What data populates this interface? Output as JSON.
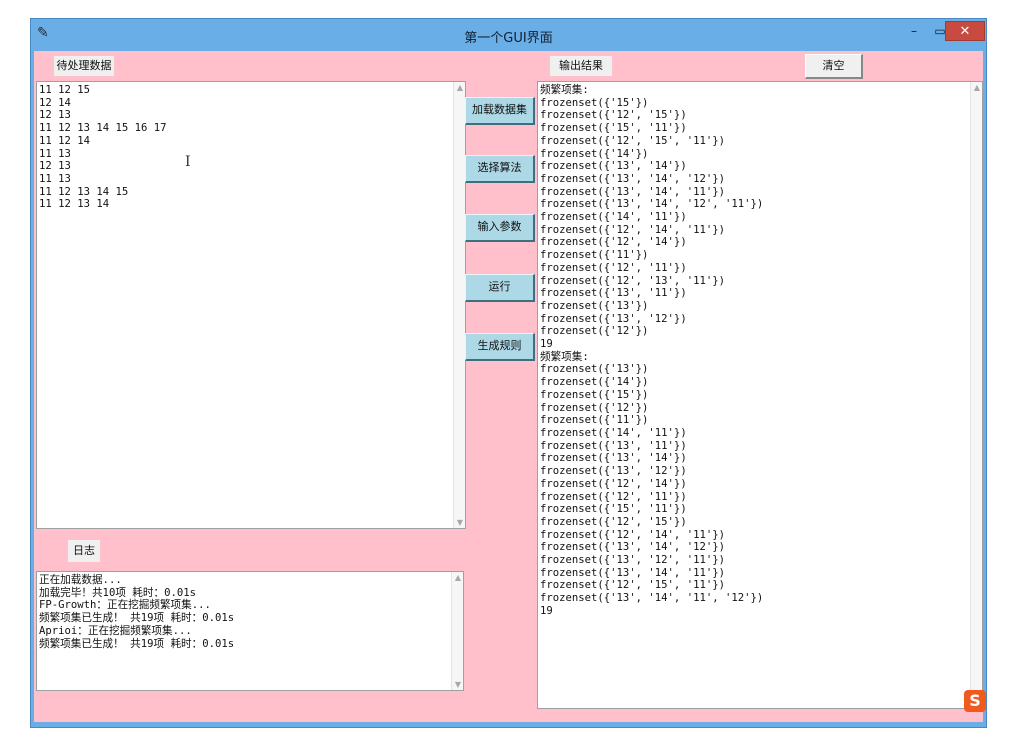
{
  "window": {
    "title": "第一个GUI界面",
    "app_icon": "feather-icon",
    "controls": {
      "minimize": "–",
      "maximize": "▭",
      "close": "✕"
    }
  },
  "input_panel": {
    "label": "待处理数据",
    "lines": [
      "11 12 15",
      "12 14",
      "12 13",
      "11 12 13 14 15 16 17",
      "11 12 14",
      "11 13",
      "12 13",
      "11 13",
      "11 12 13 14 15",
      "11 12 13 14"
    ]
  },
  "log_panel": {
    "label": "日志",
    "lines": [
      "正在加载数据...",
      "加载完毕！共10项 耗时：0.01s",
      "FP-Growth：正在挖掘频繁项集...",
      "频繁项集已生成！ 共19项 耗时：0.01s",
      "Aprioi：正在挖掘频繁项集...",
      "频繁项集已生成！ 共19项 耗时：0.01s"
    ]
  },
  "actions": [
    {
      "name": "load-data-button",
      "label": "加载数据集"
    },
    {
      "name": "select-algorithm-button",
      "label": "选择算法"
    },
    {
      "name": "input-params-button",
      "label": "输入参数"
    },
    {
      "name": "run-button",
      "label": "运行"
    },
    {
      "name": "generate-rules-button",
      "label": "生成规则"
    }
  ],
  "output_panel": {
    "label": "输出结果",
    "clear_label": "清空",
    "lines": [
      "频繁项集:",
      "frozenset({'15'})",
      "frozenset({'12', '15'})",
      "frozenset({'15', '11'})",
      "frozenset({'12', '15', '11'})",
      "frozenset({'14'})",
      "frozenset({'13', '14'})",
      "frozenset({'13', '14', '12'})",
      "frozenset({'13', '14', '11'})",
      "frozenset({'13', '14', '12', '11'})",
      "frozenset({'14', '11'})",
      "frozenset({'12', '14', '11'})",
      "frozenset({'12', '14'})",
      "frozenset({'11'})",
      "frozenset({'12', '11'})",
      "frozenset({'12', '13', '11'})",
      "frozenset({'13', '11'})",
      "frozenset({'13'})",
      "frozenset({'13', '12'})",
      "frozenset({'12'})",
      "19",
      "频繁项集:",
      "frozenset({'13'})",
      "frozenset({'14'})",
      "frozenset({'15'})",
      "frozenset({'12'})",
      "frozenset({'11'})",
      "frozenset({'14', '11'})",
      "frozenset({'13', '11'})",
      "frozenset({'13', '14'})",
      "frozenset({'13', '12'})",
      "frozenset({'12', '14'})",
      "frozenset({'12', '11'})",
      "frozenset({'15', '11'})",
      "frozenset({'12', '15'})",
      "frozenset({'12', '14', '11'})",
      "frozenset({'13', '14', '12'})",
      "frozenset({'13', '12', '11'})",
      "frozenset({'13', '14', '11'})",
      "frozenset({'12', '15', '11'})",
      "frozenset({'13', '14', '11', '12'})",
      "19"
    ]
  },
  "tray": {
    "logo_text": "S"
  },
  "colors": {
    "background": "#ffc0cb",
    "button": "#add8e6",
    "frame": "#6aaee8",
    "close": "#c94a3f"
  }
}
